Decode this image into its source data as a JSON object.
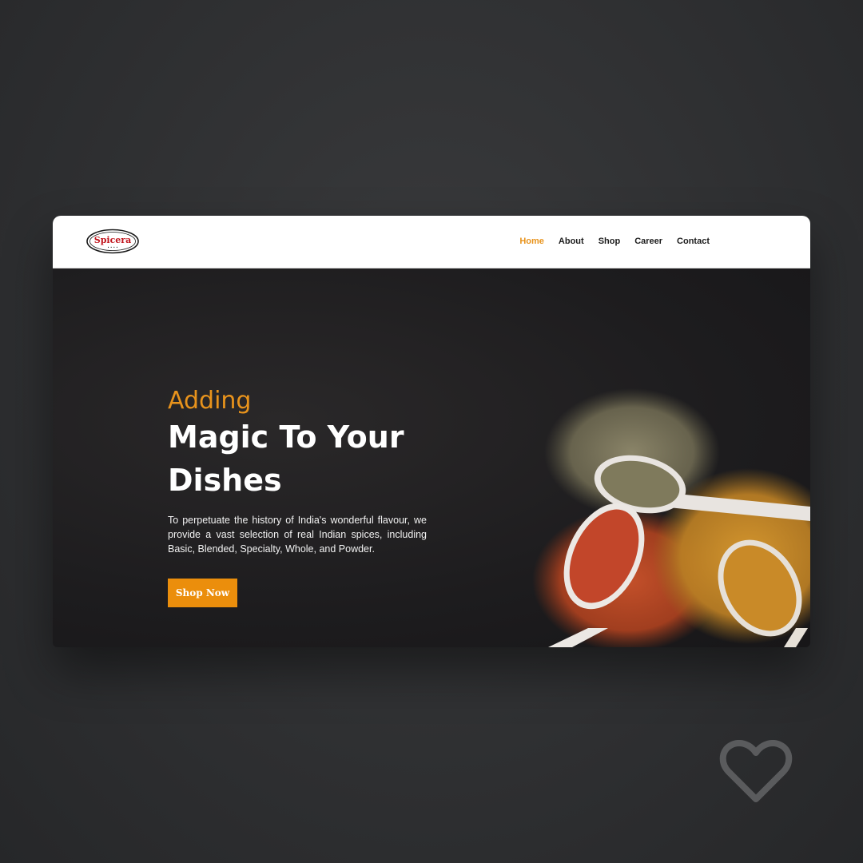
{
  "brand": {
    "logo_text": "Spicera",
    "logo_subtext": "• • • •"
  },
  "nav": {
    "items": [
      {
        "label": "Home",
        "active": true
      },
      {
        "label": "About",
        "active": false
      },
      {
        "label": "Shop",
        "active": false
      },
      {
        "label": "Career",
        "active": false
      },
      {
        "label": "Contact",
        "active": false
      }
    ]
  },
  "hero": {
    "eyebrow": "Adding",
    "headline": "Magic To Your Dishes",
    "description": "To perpetuate the history of India's wonderful flavour, we provide a vast selection of real Indian spices, including Basic, Blended, Specialty, Whole, and Powder.",
    "cta_label": "Shop Now"
  },
  "colors": {
    "accent": "#e8931c",
    "button": "#eb8e0c",
    "logo_red": "#c0121a",
    "hero_bg": "#1f1e20"
  },
  "icons": {
    "favorite": "heart-icon"
  }
}
